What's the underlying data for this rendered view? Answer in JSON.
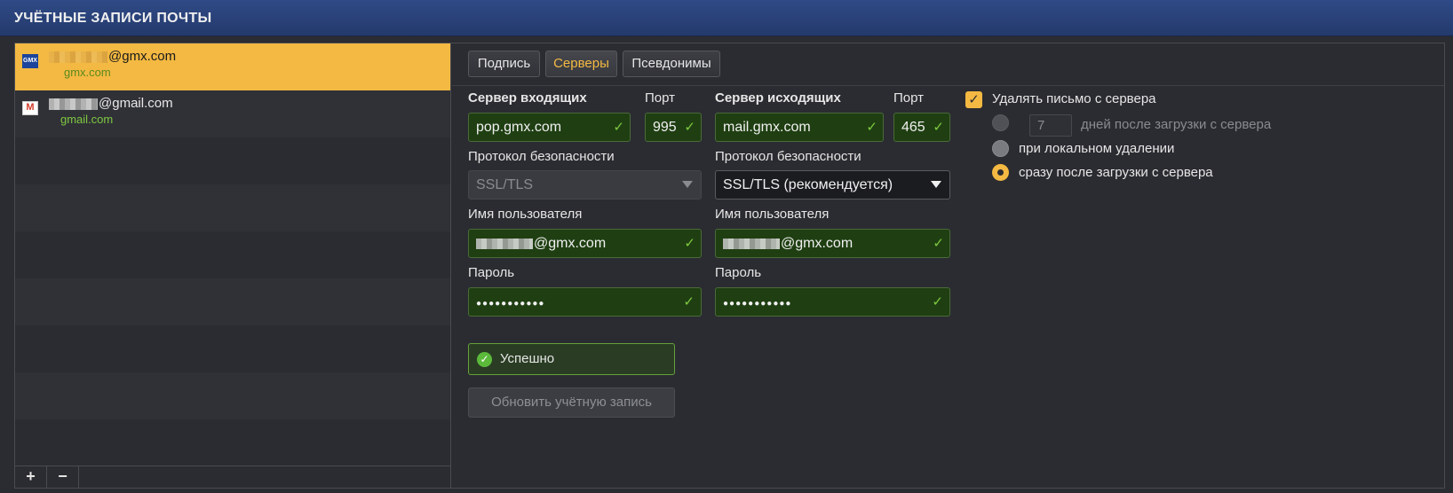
{
  "title": "УЧЁТНЫЕ ЗАПИСИ ПОЧТЫ",
  "accounts": [
    {
      "icon": "gmx-logo-icon",
      "badge": "GMX",
      "email_suffix": "@gmx.com",
      "host": "gmx.com",
      "selected": true
    },
    {
      "icon": "gmail-logo-icon",
      "badge": "M",
      "email_suffix": "@gmail.com",
      "host": "gmail.com",
      "selected": false
    }
  ],
  "toolbar": {
    "add": "+",
    "remove": "−"
  },
  "tabs": [
    {
      "label": "Подпись",
      "active": false
    },
    {
      "label": "Серверы",
      "active": true
    },
    {
      "label": "Псевдонимы",
      "active": false
    }
  ],
  "incoming": {
    "server_label": "Сервер входящих",
    "port_label": "Порт",
    "server": "pop.gmx.com",
    "port": "995",
    "security_label": "Протокол безопасности",
    "security": "SSL/TLS",
    "username_label": "Имя пользователя",
    "username_suffix": "@gmx.com",
    "password_label": "Пароль",
    "password": "●●●●●●●●●●●"
  },
  "outgoing": {
    "server_label": "Сервер исходящих",
    "port_label": "Порт",
    "server": "mail.gmx.com",
    "port": "465",
    "security_label": "Протокол безопасности",
    "security": "SSL/TLS (рекомендуется)",
    "username_label": "Имя пользователя",
    "username_suffix": "@gmx.com",
    "password_label": "Пароль",
    "password": "●●●●●●●●●●●"
  },
  "status": {
    "text": "Успешно"
  },
  "update_button": "Обновить учётную запись",
  "delete_options": {
    "checkbox_label": "Удалять письмо с сервера",
    "checked": true,
    "days_value": "7",
    "after_days_label": "дней после загрузки с сервера",
    "on_local_delete_label": "при локальном удалении",
    "immediately_label": "сразу после загрузки с сервера",
    "selected": "immediately"
  },
  "colors": {
    "accent": "#f4b942",
    "title_bar": "#2f4a86",
    "valid_field": "#1f3f12",
    "success_green": "#5cba3b",
    "host_green": "#7ec840"
  }
}
